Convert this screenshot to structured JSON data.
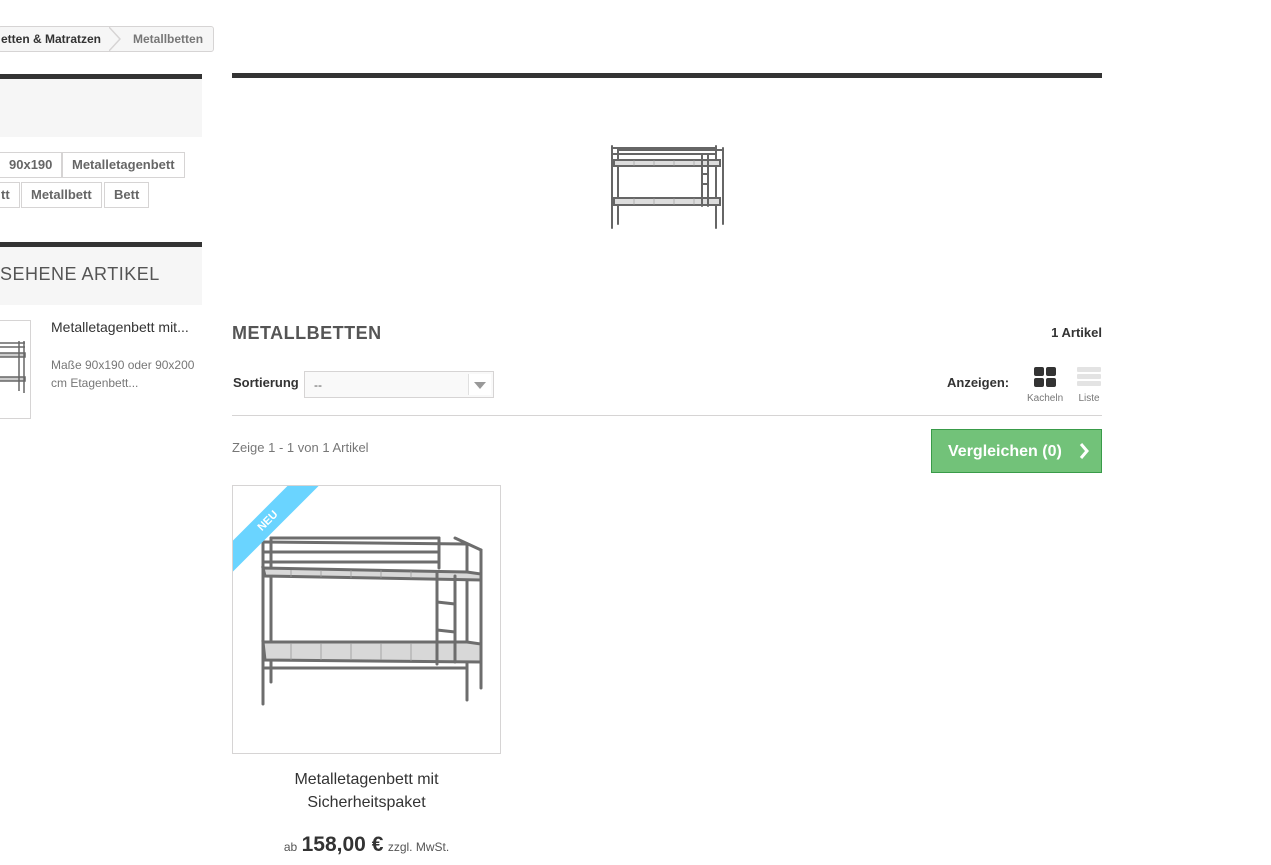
{
  "breadcrumb": {
    "items": [
      "etten & Matratzen",
      "Metallbetten"
    ]
  },
  "tags": [
    "90x190",
    "Metalletagenbett",
    "tt",
    "Metallbett",
    "Bett"
  ],
  "viewed": {
    "heading": "SEHENE ARTIKEL",
    "item_title": "Metalletagenbett mit...",
    "item_desc": "Maße 90x190 oder 90x200 cm Etagenbett..."
  },
  "category": {
    "title": "METALLBETTEN",
    "count": "1 Artikel"
  },
  "sort": {
    "label": "Sortierung",
    "value": "--"
  },
  "view": {
    "label": "Anzeigen:",
    "grid_label": "Kacheln",
    "list_label": "Liste"
  },
  "showing": "Zeige 1 - 1 von 1 Artikel",
  "compare": {
    "label": "Vergleichen (0)"
  },
  "product": {
    "badge": "NEU",
    "name_line1": "Metalletagenbett mit",
    "name_line2": "Sicherheitspaket",
    "price_prefix": "ab",
    "price": "158,00 €",
    "tax": "zzgl. MwSt."
  },
  "colors": {
    "accent_green": "#72c279",
    "badge_blue": "#6ad4ff",
    "dark_bar": "#333333"
  }
}
